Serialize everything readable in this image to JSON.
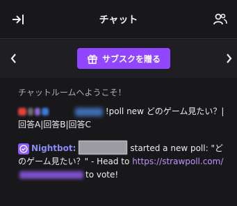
{
  "header": {
    "title": "チャット"
  },
  "promo": {
    "gift_label": "サブスクを贈る"
  },
  "chat": {
    "welcome": "チャットルームへようこそ！",
    "message1": {
      "text": "!poll new どのゲーム見たい？|回答A|回答B|回答C"
    },
    "message2": {
      "author": "Nightbot:",
      "text_before": "started a new poll: \"どのゲーム見たい？\" - Head to",
      "link_prefix": "https://strawpoll.com/",
      "text_after": "to vote!"
    }
  },
  "icons": {
    "collapse": "collapse-arrow-icon",
    "users": "community-icon",
    "gift": "gift-icon",
    "prev": "chevron-left-icon",
    "next": "chevron-right-icon",
    "bot_badge": "verified-bot-badge-icon"
  },
  "colors": {
    "accent": "#9147ff",
    "link": "#bf94ff",
    "bot_name": "#8a8cf5",
    "background": "#18181b"
  }
}
